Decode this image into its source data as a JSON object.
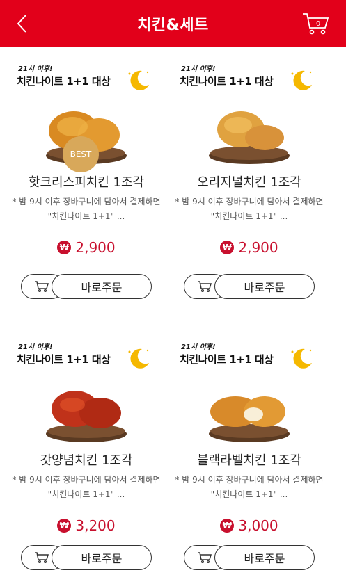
{
  "header": {
    "title": "치킨&세트",
    "cart_count": "0"
  },
  "promo": {
    "small_text": "21시 이후!",
    "big_text": "치킨나이트 1+1 대상"
  },
  "products": [
    {
      "name": "핫크리스피치킨 1조각",
      "desc": "* 밤 9시 이후 장바구니에 담아서 결제하면 \"치킨나이트 1+1\" ...",
      "price": "2,900",
      "badge": "BEST"
    },
    {
      "name": "오리지널치킨 1조각",
      "desc": "* 밤 9시 이후 장바구니에 담아서 결제하면 \"치킨나이트 1+1\" ...",
      "price": "2,900"
    },
    {
      "name": "갓양념치킨 1조각",
      "desc": "* 밤 9시 이후 장바구니에 담아서 결제하면 \"치킨나이트 1+1\" ...",
      "price": "3,200"
    },
    {
      "name": "블랙라벨치킨 1조각",
      "desc": "* 밤 9시 이후 장바구니에 담아서 결제하면 \"치킨나이트 1+1\" ...",
      "price": "3,000"
    }
  ],
  "buttons": {
    "order_label": "바로주문"
  },
  "currency_symbol": "₩",
  "colors": {
    "brand_red": "#e2001a",
    "price_red": "#c8102e",
    "best_gold": "#d8a85a"
  },
  "icons": {
    "back": "chevron-left-icon",
    "cart": "cart-icon",
    "moon": "moon-icon",
    "won": "won-icon"
  }
}
